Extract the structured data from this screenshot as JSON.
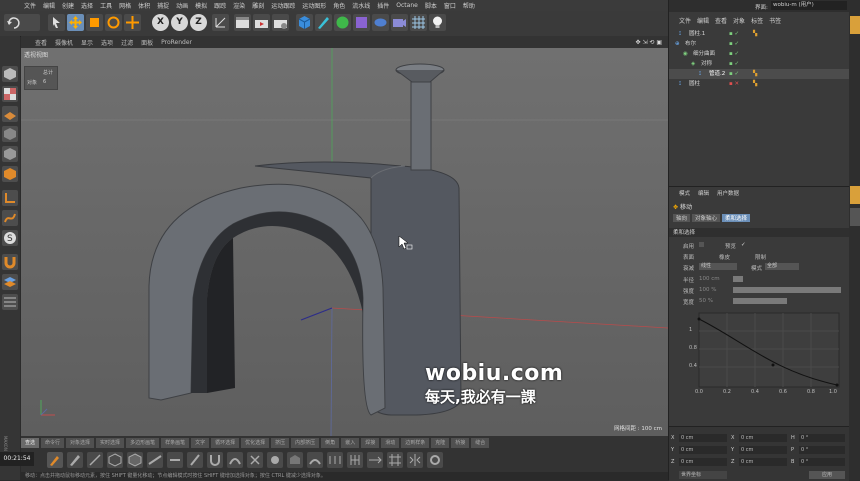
{
  "menu": [
    "文件",
    "编辑",
    "创建",
    "选择",
    "工具",
    "网格",
    "体积",
    "捕捉",
    "动画",
    "模拟",
    "跟踪",
    "渲染",
    "雕刻",
    "运动跟踪",
    "运动图形",
    "角色",
    "流水线",
    "插件",
    "Octane",
    "脚本",
    "窗口",
    "帮助"
  ],
  "viewport_menu": [
    "查看",
    "摄像机",
    "显示",
    "选项",
    "过滤",
    "面板",
    "ProRender"
  ],
  "viewport_label": "透视视图",
  "hud": {
    "label_a": "总计",
    "label_b": "对象",
    "value_b": "6"
  },
  "grid_info": "网格间距 : 100 cm",
  "watermark": {
    "line1": "wobiu.com",
    "line2": "每天,我必有一課"
  },
  "timestamp": "00:21:54",
  "bottom_tabs": [
    "查选",
    "命令行",
    "对象选择",
    "实时选择",
    "多边形画笔",
    "样条画笔",
    "文字",
    "循环选择",
    "优化选择",
    "挤压",
    "内部挤压",
    "倒角",
    "嵌入",
    "焊接",
    "滑动",
    "边到样条",
    "克隆",
    "桥接",
    "缝合"
  ],
  "status_text": "移动：点击并拖动鼠标移动元素，按住 SHIFT 键量化移动；节点编辑模式时按住 SHIFT 键增加选择对象；按住 CTRL 键减少选择对象。",
  "right": {
    "interface_label": "界面:",
    "interface_value": "wobiu-m (用户)",
    "menu": [
      "文件",
      "编辑",
      "查看",
      "对象",
      "标签",
      "书签"
    ],
    "objects": [
      {
        "name": "圆柱.1"
      },
      {
        "name": "布尔"
      },
      {
        "name": "细分曲面"
      },
      {
        "name": "对称"
      },
      {
        "name": "管道.2"
      },
      {
        "name": "圆柱"
      }
    ],
    "attr_menu": [
      "模式",
      "编辑",
      "用户数据"
    ],
    "attr_title": "移动",
    "attr_tabs": [
      "轴向",
      "对象轴心",
      "柔和选择"
    ],
    "attr_section": "柔和选择",
    "attr_fields": [
      {
        "label": "启用",
        "value": ""
      },
      {
        "label": "预览",
        "value": "✓"
      },
      {
        "label": "表面",
        "value": ""
      },
      {
        "label": "橡皮",
        "value": ""
      },
      {
        "label": "限制",
        "value": ""
      },
      {
        "label": "衰减",
        "value": "线性"
      },
      {
        "label": "模式",
        "value": "全部"
      },
      {
        "label": "半径",
        "value": "100 cm"
      },
      {
        "label": "强度",
        "value": "100 %"
      },
      {
        "label": "宽度",
        "value": "50 %"
      }
    ],
    "graph_y": [
      "1",
      "0.8",
      "0.4"
    ],
    "graph_x": [
      "0.0",
      "0.2",
      "0.4",
      "0.6",
      "0.8",
      "1.0"
    ],
    "coords": [
      {
        "axis": "X",
        "pos": "0 cm",
        "size": "0 cm",
        "rot_label": "H",
        "rot": "0 °"
      },
      {
        "axis": "Y",
        "pos": "0 cm",
        "size": "0 cm",
        "rot_label": "P",
        "rot": "0 °"
      },
      {
        "axis": "Z",
        "pos": "0 cm",
        "size": "0 cm",
        "rot_label": "B",
        "rot": "0 °"
      }
    ],
    "coord_mode": "世界坐标",
    "apply_label": "应用"
  }
}
